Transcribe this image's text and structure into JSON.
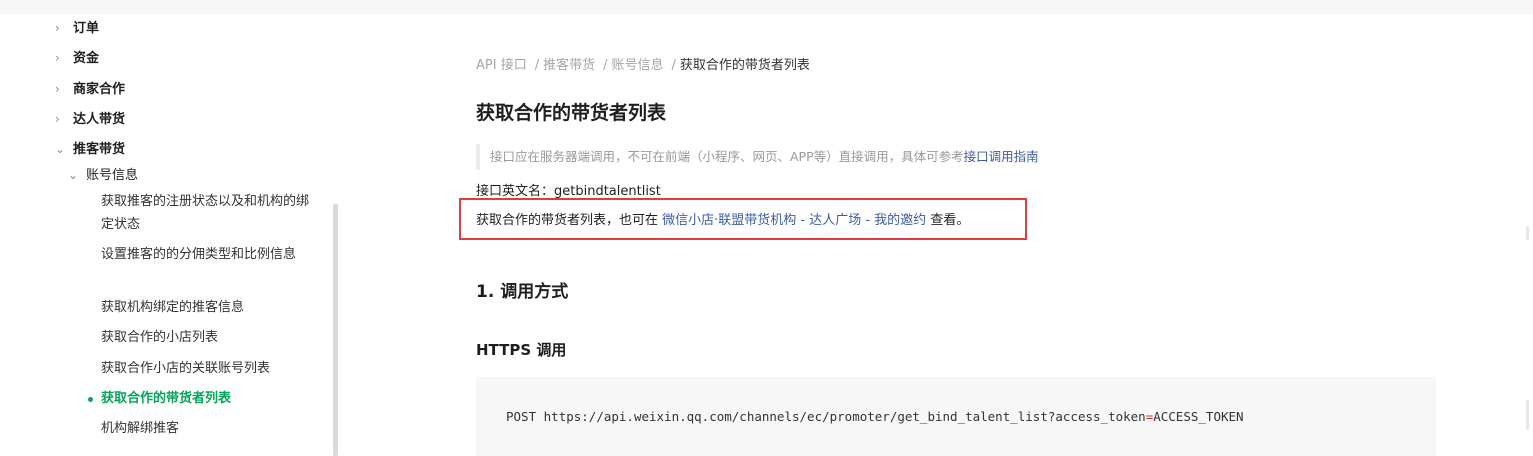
{
  "sidebar": {
    "top_items": [
      {
        "label": "订单",
        "expanded": false
      },
      {
        "label": "资金",
        "expanded": false
      },
      {
        "label": "商家合作",
        "expanded": false
      },
      {
        "label": "达人带货",
        "expanded": false
      },
      {
        "label": "推客带货",
        "expanded": true
      }
    ],
    "sub_group": {
      "label": "账号信息",
      "expanded": true
    },
    "leaves": [
      {
        "label": "获取推客的注册状态以及和机构的绑定状态",
        "active": false
      },
      {
        "label": "设置推客的的分佣类型和比例信息",
        "active": false
      },
      {
        "label": "获取机构绑定的推客信息",
        "active": false
      },
      {
        "label": "获取合作的小店列表",
        "active": false
      },
      {
        "label": "获取合作小店的关联账号列表",
        "active": false
      },
      {
        "label": "获取合作的带货者列表",
        "active": true
      },
      {
        "label": "机构解绑推客",
        "active": false
      }
    ],
    "icons": {
      "collapsed": "chevron-right-icon",
      "expanded": "chevron-down-icon"
    },
    "active_color": "#07a35a"
  },
  "breadcrumb": {
    "items": [
      "API 接口",
      "推客带货",
      "账号信息",
      "获取合作的带货者列表"
    ],
    "separator": "/"
  },
  "page": {
    "title": "获取合作的带货者列表",
    "notice_text": "接口应在服务器端调用，不可在前端（小程序、网页、APP等）直接调用，具体可参考",
    "notice_link": "接口调用指南",
    "english_name": "接口英文名：getbindtalentlist",
    "desc_prefix": "获取合作的带货者列表，也可在 ",
    "desc_link": "微信小店·联盟带货机构 - 达人广场 - 我的邀约",
    "desc_suffix": " 查看。",
    "section1_title": "1. 调用方式",
    "section1_sub": "HTTPS 调用",
    "code_method": "POST",
    "code_url_prefix": "https://api.weixin.qq.com/channels/ec/promoter/get_bind_talent_list?access_token",
    "code_eq": "=",
    "code_url_suffix": "ACCESS_TOKEN"
  },
  "colors": {
    "link": "#3d5ca8",
    "highlight_border": "#e53b3b",
    "code_bg": "#f7f7f7"
  }
}
